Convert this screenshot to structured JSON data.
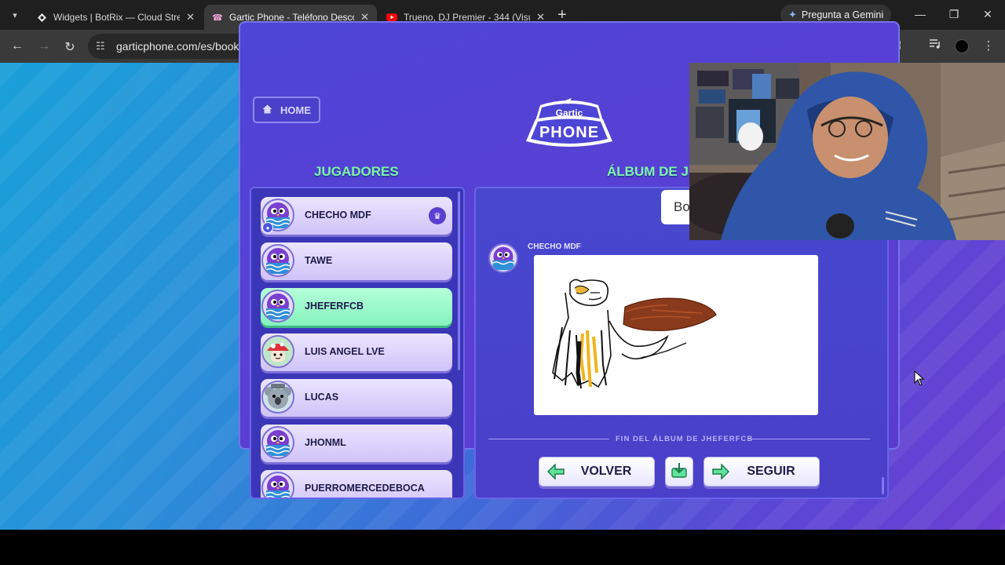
{
  "browser": {
    "tabs": [
      {
        "title": "Widgets | BotRix — Cloud Strea",
        "favicon": "botrix-icon"
      },
      {
        "title": "Gartic Phone - Teléfono Descon",
        "favicon": "gartic-icon"
      },
      {
        "title": "Trueno, DJ Premier - 344 (Visua",
        "favicon": "youtube-icon"
      }
    ],
    "gemini_label": "Pregunta a Gemini",
    "url": "garticphone.com/es/book"
  },
  "game": {
    "home_label": "HOME",
    "logo_top": "Gartic",
    "logo_bottom": "PHONE",
    "players_title": "JUGADORES",
    "album_title": "ÁLBUM DE JI",
    "players": [
      {
        "name": "CHECHO MDF",
        "avatar": "purple-bird",
        "host": true,
        "highlight": false
      },
      {
        "name": "TAWE",
        "avatar": "purple-bird",
        "host": false,
        "highlight": false
      },
      {
        "name": "JHEFERFCB",
        "avatar": "purple-bird",
        "host": false,
        "highlight": true
      },
      {
        "name": "LUIS ANGEL LVE",
        "avatar": "mushroom",
        "host": false,
        "highlight": false
      },
      {
        "name": "LUCAS",
        "avatar": "gray-koala",
        "host": false,
        "highlight": false
      },
      {
        "name": "JHONML",
        "avatar": "purple-bird",
        "host": false,
        "highlight": false
      },
      {
        "name": "PUERROMERCEDEBOCA",
        "avatar": "purple-bird",
        "host": false,
        "highlight": false
      }
    ],
    "bubble_text": "Bo",
    "drawing_author": "CHECHO MDF",
    "end_text": "FIN DEL ÁLBUM DE JHEFERFCB",
    "back_label": "VOLVER",
    "next_label": "SEGUIR"
  },
  "colors": {
    "accent_green": "#7df5a8",
    "panel": "#3b36b8"
  }
}
